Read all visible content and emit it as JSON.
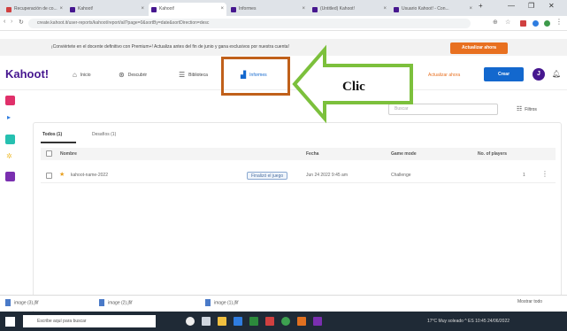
{
  "browser": {
    "tabs": [
      {
        "label": "Recuperación de co..."
      },
      {
        "label": "Kahoot!"
      },
      {
        "label": "Kahoot!"
      },
      {
        "label": "Informes"
      },
      {
        "label": "(Untitled) Kahoot!"
      },
      {
        "label": "Usuario Kahoot! - Con..."
      }
    ],
    "window_controls": [
      "—",
      "❐",
      "✕"
    ],
    "new_tab": "+",
    "address_url": "create.kahoot.it/user-reports/kahoot/report/all?page=0&sortBy=date&sortDirection=desc"
  },
  "banner": {
    "text": "¡Conviértete en el docente definitivo con Premium+! Actualiza antes del fin de junio y gana exclusivos por nuestra cuenta!",
    "button": "Actualizar ahora"
  },
  "app_nav": {
    "logo": "Kahoot!",
    "items": [
      {
        "label": "Inicio",
        "icon": "home-icon"
      },
      {
        "label": "Descubrir",
        "icon": "compass-icon"
      },
      {
        "label": "Biblioteca",
        "icon": "library-icon"
      },
      {
        "label": "Informes",
        "icon": "chart-icon"
      }
    ],
    "upgrade": "Actualizar ahora",
    "create_button": "Crear",
    "avatar_letter": "J",
    "brand_color": "#46178f",
    "accent_color": "#1368ce"
  },
  "annotation": {
    "label": "Clic",
    "arrow_color": "#7cc03c",
    "box_color": "#c0601a"
  },
  "toolbar": {
    "search_placeholder": "Buscar",
    "filter_label": "Filtros"
  },
  "reports": {
    "tabs": [
      "Todos (1)",
      "Desafíos (1)"
    ],
    "columns": [
      "Nombre",
      "Fecha",
      "Game mode",
      "No. of players"
    ],
    "rows": [
      {
        "name": "kahoot-name-2022",
        "badge": "Finalizó el juego",
        "date": "Jun 24 2022 9:45 am",
        "mode": "Challenge",
        "players": "1"
      }
    ]
  },
  "downloads": {
    "items": [
      "image (3).jfif",
      "image (2).jfif",
      "image (1).jfif"
    ],
    "show_all": "Mostrar todo"
  },
  "taskbar": {
    "search_placeholder": "Escribe aquí para buscar",
    "tray_text": "17°C Muy soleado  ^  ES  10:45  24/06/2022"
  }
}
